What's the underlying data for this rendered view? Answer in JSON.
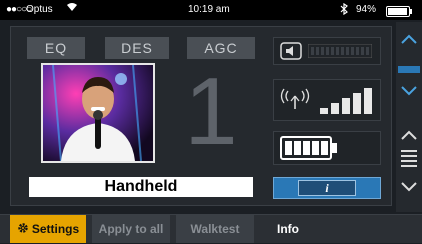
{
  "status_bar": {
    "signal_dots": "●●○○○",
    "carrier": "Optus",
    "wifi_icon": "wifi-icon",
    "time": "10:19 am",
    "bluetooth_icon": "bluetooth-icon",
    "battery_percent": "94%",
    "battery_level": 0.94
  },
  "channel_panel": {
    "tabs": [
      "EQ",
      "DES",
      "AGC"
    ],
    "channel_number": "1",
    "device_name": "Handheld",
    "info_label": "i",
    "rf_signal_bars_lit": 5,
    "audio_meter_segments_lit": 0,
    "battery_segments_lit": 5,
    "battery_segments_total": 5
  },
  "right_nav": {
    "up_icon": "chevron-up-icon",
    "down_icon": "chevron-down-icon",
    "menu_icon": "hamburger-menu-icon"
  },
  "bottom_tabs": {
    "settings": "Settings",
    "apply_to_all": "Apply to all",
    "walktest": "Walktest",
    "info": "Info"
  },
  "colors": {
    "accent_blue": "#2a78b6",
    "settings_gold": "#e6a400",
    "panel_bg": "#25292e"
  }
}
